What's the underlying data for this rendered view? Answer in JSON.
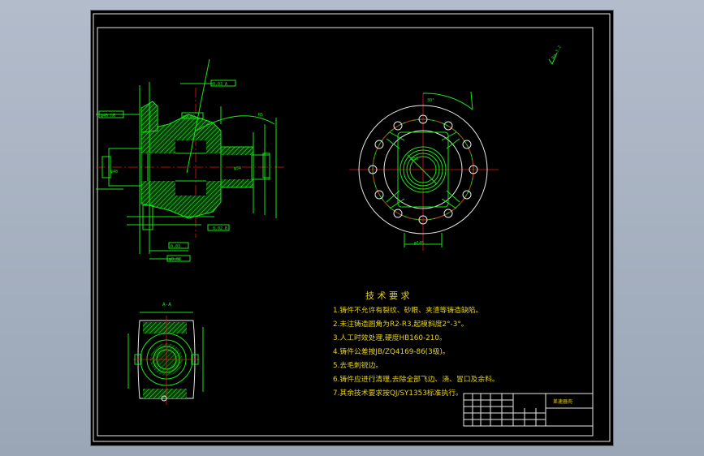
{
  "drawing": {
    "section_label": "A-A",
    "title_block_name": "差速器壳",
    "tech_requirements": {
      "title": "技 术 要 求",
      "items": [
        "1.铸件不允许有裂纹、砂眼、夹渣等铸造缺陷。",
        "2.未注铸造圆角为R2-R3,起模斜度2°-3°。",
        "3.人工时效处理,硬度HB160-210。",
        "4.铸件公差按JB/ZQ4169-86(3级)。",
        "5.去毛刺锐边。",
        "6.铸件应进行清理,去除全部飞边、浇、冒口及余料。",
        "7.其余技术要求按QJ/SY1353标准执行。"
      ]
    },
    "roughness_note": "Ra 3.2"
  },
  "colors": {
    "sheet": "#000000",
    "linework": "#19e619",
    "outline": "#e8e8e8",
    "centerline": "#e01818",
    "text": "#e6d21a"
  }
}
